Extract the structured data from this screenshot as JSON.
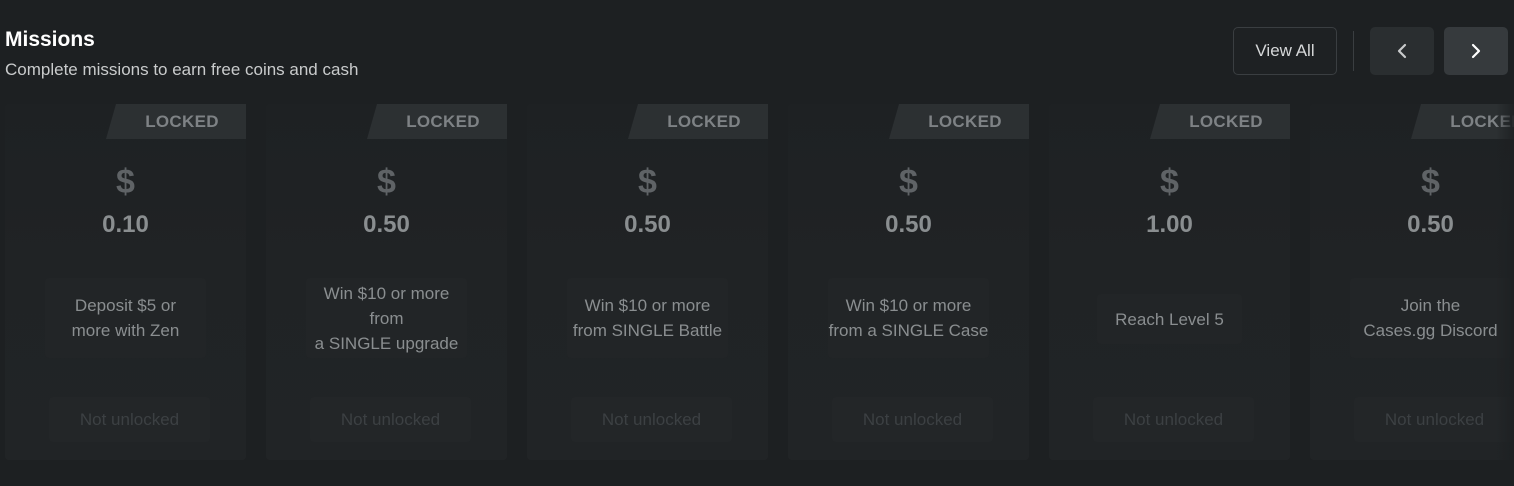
{
  "header": {
    "title": "Missions",
    "subtitle": "Complete missions to earn free coins and cash"
  },
  "controls": {
    "view_all_label": "View All",
    "prev_icon": "chevron-left-icon",
    "next_icon": "chevron-right-icon"
  },
  "missions": [
    {
      "status": "LOCKED",
      "currency_symbol": "$",
      "amount": "0.10",
      "description": "Deposit $5 or\nmore with Zen",
      "action_label": "Not unlocked"
    },
    {
      "status": "LOCKED",
      "currency_symbol": "$",
      "amount": "0.50",
      "description": "Win $10 or more from\na SINGLE upgrade",
      "action_label": "Not unlocked"
    },
    {
      "status": "LOCKED",
      "currency_symbol": "$",
      "amount": "0.50",
      "description": "Win $10 or more\nfrom SINGLE Battle",
      "action_label": "Not unlocked"
    },
    {
      "status": "LOCKED",
      "currency_symbol": "$",
      "amount": "0.50",
      "description": "Win $10 or more\nfrom a SINGLE Case",
      "action_label": "Not unlocked"
    },
    {
      "status": "LOCKED",
      "currency_symbol": "$",
      "amount": "1.00",
      "description": "Reach Level 5",
      "action_label": "Not unlocked"
    },
    {
      "status": "LOCKED",
      "currency_symbol": "$",
      "amount": "0.50",
      "description": "Join the\nCases.gg Discord",
      "action_label": "Not unlocked"
    }
  ],
  "colors": {
    "background": "#1d2022",
    "title": "#ffffff",
    "locked_tab": "#2c3032",
    "amount_text": "#8a8e90"
  }
}
